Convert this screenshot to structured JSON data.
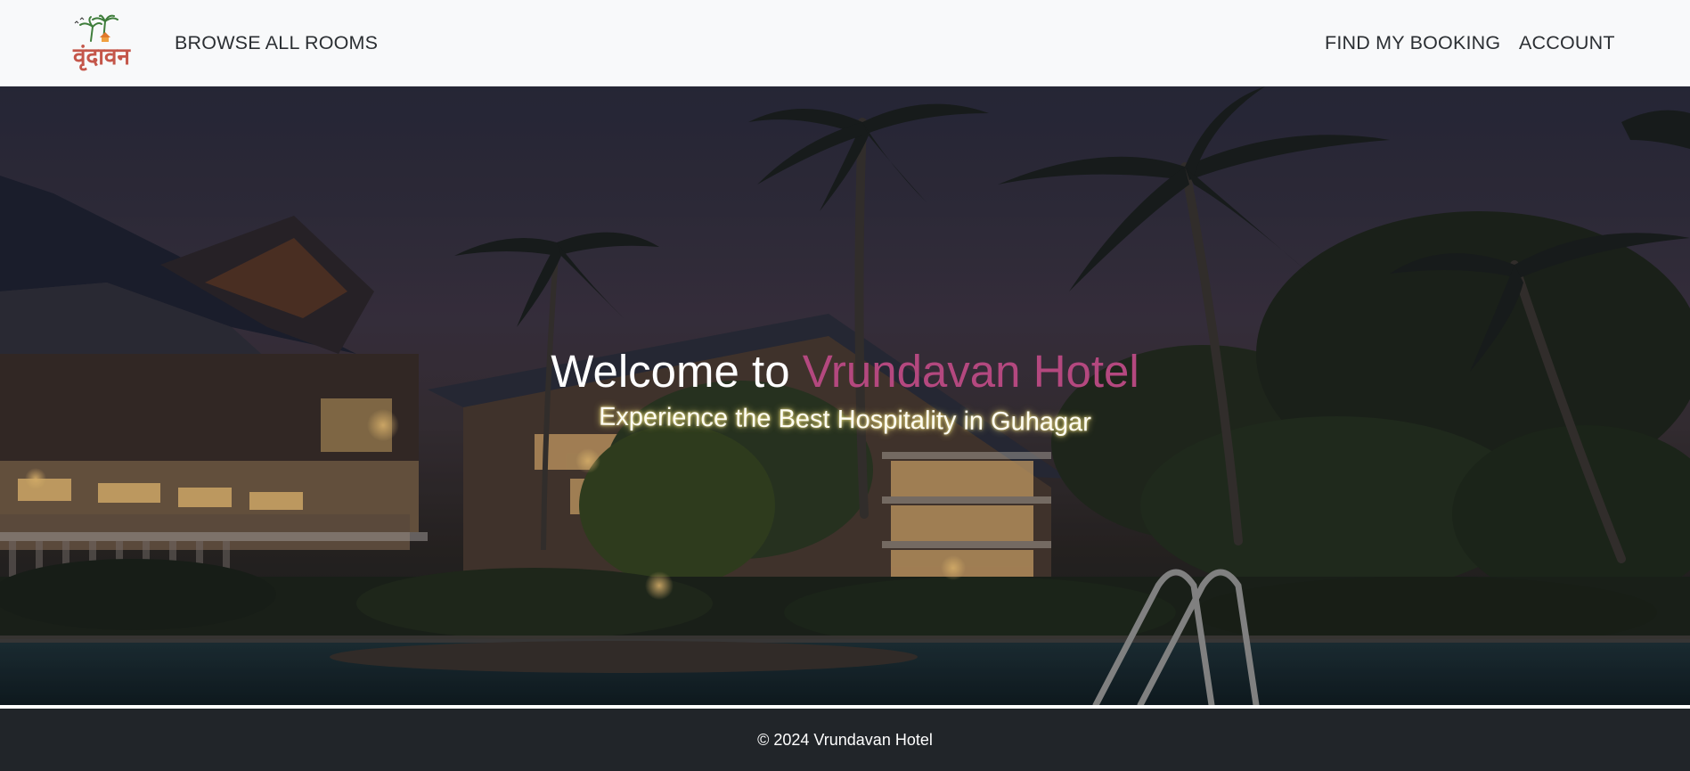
{
  "navbar": {
    "logo_text": "वृंदावन",
    "browse_label": "BROWSE ALL ROOMS",
    "find_booking_label": "FIND MY BOOKING",
    "account_label": "ACCOUNT"
  },
  "hero": {
    "title_prefix": "Welcome to ",
    "title_accent": "Vrundavan Hotel",
    "subtitle": "Experience the Best Hospitality in Guhagar"
  },
  "footer": {
    "copyright": "© 2024 Vrundavan Hotel"
  },
  "colors": {
    "navbar_bg": "#f8f9fa",
    "nav_text": "#2b2f33",
    "accent": "#b4487f",
    "footer_bg": "#212529",
    "footer_text": "#ffffff"
  },
  "icons": {
    "logo": "vrundavan-logo-icon"
  }
}
